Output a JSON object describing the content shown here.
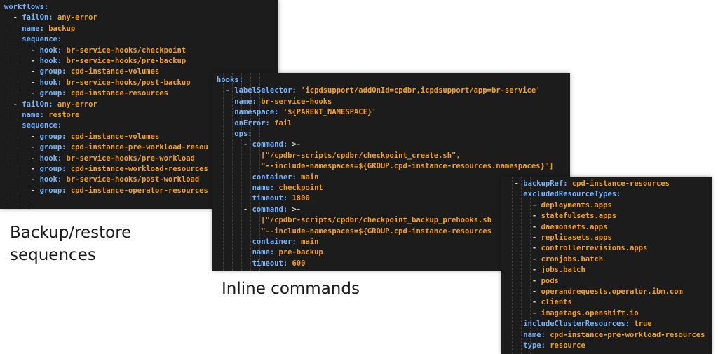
{
  "colors": {
    "background": "#ffffff",
    "panel": "#1c1c1c",
    "key": "#77b4ff",
    "string": "#f6a021",
    "punctuation": "#d9d9d9"
  },
  "captions": {
    "left": [
      "Backup/restore",
      "sequences"
    ],
    "middle": "Inline commands"
  },
  "panels": {
    "workflows": {
      "lines": [
        [
          [
            "workflows:",
            "k"
          ]
        ],
        [
          [
            "  - ",
            "p"
          ],
          [
            "failOn: ",
            "k"
          ],
          [
            "any-error",
            "s"
          ]
        ],
        [
          [
            "    ",
            "p"
          ],
          [
            "name: ",
            "k"
          ],
          [
            "backup",
            "s"
          ]
        ],
        [
          [
            "    ",
            "p"
          ],
          [
            "sequence:",
            "k"
          ]
        ],
        [
          [
            "      - ",
            "p"
          ],
          [
            "hook: ",
            "k"
          ],
          [
            "br-service-hooks/checkpoint",
            "s"
          ]
        ],
        [
          [
            "      - ",
            "p"
          ],
          [
            "hook: ",
            "k"
          ],
          [
            "br-service-hooks/pre-backup",
            "s"
          ]
        ],
        [
          [
            "      - ",
            "p"
          ],
          [
            "group: ",
            "k"
          ],
          [
            "cpd-instance-volumes",
            "s"
          ]
        ],
        [
          [
            "      - ",
            "p"
          ],
          [
            "hook: ",
            "k"
          ],
          [
            "br-service-hooks/post-backup",
            "s"
          ]
        ],
        [
          [
            "      - ",
            "p"
          ],
          [
            "group: ",
            "k"
          ],
          [
            "cpd-instance-resources",
            "s"
          ]
        ],
        [
          [
            "  - ",
            "p"
          ],
          [
            "failOn: ",
            "k"
          ],
          [
            "any-error",
            "s"
          ]
        ],
        [
          [
            "    ",
            "p"
          ],
          [
            "name: ",
            "k"
          ],
          [
            "restore",
            "s"
          ]
        ],
        [
          [
            "    ",
            "p"
          ],
          [
            "sequence:",
            "k"
          ]
        ],
        [
          [
            "      - ",
            "p"
          ],
          [
            "group: ",
            "k"
          ],
          [
            "cpd-instance-volumes",
            "s"
          ]
        ],
        [
          [
            "      - ",
            "p"
          ],
          [
            "group: ",
            "k"
          ],
          [
            "cpd-instance-pre-workload-resou",
            "s"
          ]
        ],
        [
          [
            "      - ",
            "p"
          ],
          [
            "hook: ",
            "k"
          ],
          [
            "br-service-hooks/pre-workload",
            "s"
          ]
        ],
        [
          [
            "      - ",
            "p"
          ],
          [
            "group: ",
            "k"
          ],
          [
            "cpd-instance-workload-resources",
            "s"
          ]
        ],
        [
          [
            "      - ",
            "p"
          ],
          [
            "hook: ",
            "k"
          ],
          [
            "br-service-hooks/post-workload",
            "s"
          ]
        ],
        [
          [
            "      - ",
            "p"
          ],
          [
            "group: ",
            "k"
          ],
          [
            "cpd-instance-operator-resources",
            "s"
          ]
        ]
      ]
    },
    "hooks": {
      "lines": [
        [
          [
            "hooks:",
            "k"
          ]
        ],
        [
          [
            "  - ",
            "p"
          ],
          [
            "labelSelector: ",
            "k"
          ],
          [
            "'icpdsupport/addOnId=cpdbr,icpdsupport/app=br-service'",
            "s"
          ]
        ],
        [
          [
            "    ",
            "p"
          ],
          [
            "name: ",
            "k"
          ],
          [
            "br-service-hooks",
            "s"
          ]
        ],
        [
          [
            "    ",
            "p"
          ],
          [
            "namespace: ",
            "k"
          ],
          [
            "'${PARENT_NAMESPACE}'",
            "s"
          ]
        ],
        [
          [
            "    ",
            "p"
          ],
          [
            "onError: ",
            "k"
          ],
          [
            "fail",
            "s"
          ]
        ],
        [
          [
            "    ",
            "p"
          ],
          [
            "ops:",
            "k"
          ]
        ],
        [
          [
            "      - ",
            "p"
          ],
          [
            "command: ",
            "k"
          ],
          [
            ">-",
            "p"
          ]
        ],
        [
          [
            "          ",
            "p"
          ],
          [
            "[\"/cpdbr-scripts/cpdbr/checkpoint_create.sh\",",
            "s"
          ]
        ],
        [
          [
            "          ",
            "p"
          ],
          [
            "\"--include-namespaces=${GROUP.cpd-instance-resources.namespaces}\"]",
            "s"
          ]
        ],
        [
          [
            "        ",
            "p"
          ],
          [
            "container: ",
            "k"
          ],
          [
            "main",
            "s"
          ]
        ],
        [
          [
            "        ",
            "p"
          ],
          [
            "name: ",
            "k"
          ],
          [
            "checkpoint",
            "s"
          ]
        ],
        [
          [
            "        ",
            "p"
          ],
          [
            "timeout: ",
            "k"
          ],
          [
            "1800",
            "s"
          ]
        ],
        [
          [
            "      - ",
            "p"
          ],
          [
            "command: ",
            "k"
          ],
          [
            ">-",
            "p"
          ]
        ],
        [
          [
            "          ",
            "p"
          ],
          [
            "[\"/cpdbr-scripts/cpdbr/checkpoint_backup_prehooks.sh",
            "s"
          ]
        ],
        [
          [
            "          ",
            "p"
          ],
          [
            "\"--include-namespaces=${GROUP.cpd-instance-resources",
            "s"
          ]
        ],
        [
          [
            "        ",
            "p"
          ],
          [
            "container: ",
            "k"
          ],
          [
            "main",
            "s"
          ]
        ],
        [
          [
            "        ",
            "p"
          ],
          [
            "name: ",
            "k"
          ],
          [
            "pre-backup",
            "s"
          ]
        ],
        [
          [
            "        ",
            "p"
          ],
          [
            "timeout: ",
            "k"
          ],
          [
            "600",
            "s"
          ]
        ]
      ]
    },
    "backupref": {
      "lines": [
        [
          [
            "  - ",
            "p"
          ],
          [
            "backupRef: ",
            "k"
          ],
          [
            "cpd-instance-resources",
            "s"
          ]
        ],
        [
          [
            "    ",
            "p"
          ],
          [
            "excludedResourceTypes:",
            "k"
          ]
        ],
        [
          [
            "      - ",
            "p"
          ],
          [
            "deployments.apps",
            "s"
          ]
        ],
        [
          [
            "      - ",
            "p"
          ],
          [
            "statefulsets.apps",
            "s"
          ]
        ],
        [
          [
            "      - ",
            "p"
          ],
          [
            "daemonsets.apps",
            "s"
          ]
        ],
        [
          [
            "      - ",
            "p"
          ],
          [
            "replicasets.apps",
            "s"
          ]
        ],
        [
          [
            "      - ",
            "p"
          ],
          [
            "controllerrevisions.apps",
            "s"
          ]
        ],
        [
          [
            "      - ",
            "p"
          ],
          [
            "cronjobs.batch",
            "s"
          ]
        ],
        [
          [
            "      - ",
            "p"
          ],
          [
            "jobs.batch",
            "s"
          ]
        ],
        [
          [
            "      - ",
            "p"
          ],
          [
            "pods",
            "s"
          ]
        ],
        [
          [
            "      - ",
            "p"
          ],
          [
            "operandrequests.operator.ibm.com",
            "s"
          ]
        ],
        [
          [
            "      - ",
            "p"
          ],
          [
            "clients",
            "s"
          ]
        ],
        [
          [
            "      - ",
            "p"
          ],
          [
            "imagetags.openshift.io",
            "s"
          ]
        ],
        [
          [
            "    ",
            "p"
          ],
          [
            "includeClusterResources: ",
            "k"
          ],
          [
            "true",
            "s"
          ]
        ],
        [
          [
            "    ",
            "p"
          ],
          [
            "name: ",
            "k"
          ],
          [
            "cpd-instance-pre-workload-resources",
            "s"
          ]
        ],
        [
          [
            "    ",
            "p"
          ],
          [
            "type: ",
            "k"
          ],
          [
            "resource",
            "s"
          ]
        ]
      ]
    }
  }
}
